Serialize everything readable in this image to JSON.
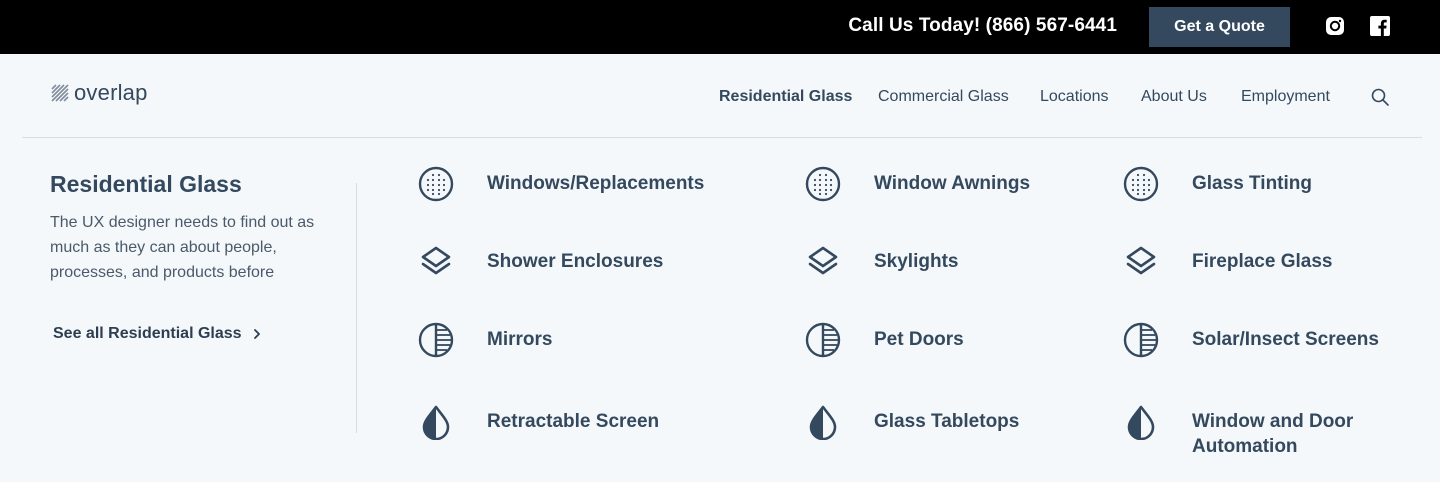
{
  "topbar": {
    "phone": "Call Us Today! (866) 567-6441",
    "quote_label": "Get a Quote",
    "social": [
      "instagram-icon",
      "facebook-icon"
    ]
  },
  "header": {
    "logo_text": "overlap",
    "nav": [
      "Residential Glass",
      "Commercial Glass",
      "Locations",
      "About Us",
      "Employment"
    ],
    "active_nav": "Residential Glass"
  },
  "panel": {
    "title": "Residential Glass",
    "description": "The UX designer needs to find out as much as they can about people, processes, and products before",
    "see_all": "See all Residential Glass"
  },
  "items": [
    {
      "label": "Windows/Replacements",
      "icon": "grid-dots-icon"
    },
    {
      "label": "Window Awnings",
      "icon": "grid-dots-icon"
    },
    {
      "label": "Glass Tinting",
      "icon": "grid-dots-icon"
    },
    {
      "label": "Shower Enclosures",
      "icon": "layers-icon"
    },
    {
      "label": "Skylights",
      "icon": "layers-icon"
    },
    {
      "label": "Fireplace Glass",
      "icon": "layers-icon"
    },
    {
      "label": "Mirrors",
      "icon": "half-circle-lines-icon"
    },
    {
      "label": "Pet Doors",
      "icon": "half-circle-lines-icon"
    },
    {
      "label": "Solar/Insect Screens",
      "icon": "half-circle-lines-icon"
    },
    {
      "label": "Retractable Screen",
      "icon": "drop-icon"
    },
    {
      "label": "Glass Tabletops",
      "icon": "drop-icon"
    },
    {
      "label": "Window and Door Automation",
      "icon": "drop-icon"
    }
  ],
  "colors": {
    "topbar_bg": "#000000",
    "quote_bg": "#34495e",
    "text": "#34495e",
    "page_bg": "#f4f8fb"
  }
}
